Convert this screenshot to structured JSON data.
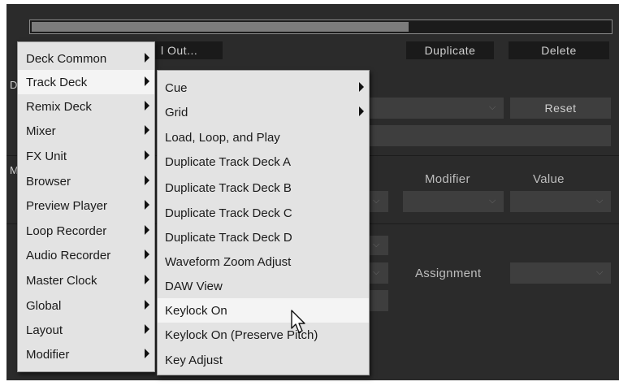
{
  "panel": {
    "progress_fraction": 0.65,
    "buttons": {
      "mapout_label": "l Out...",
      "duplicate_label": "Duplicate",
      "delete_label": "Delete",
      "reset_label": "Reset"
    },
    "headers": {
      "modifier_label": "Modifier",
      "value_label": "Value",
      "assignment_label": "Assignment"
    },
    "edge_marks": {
      "a": "D",
      "b": "M"
    }
  },
  "menu_main": {
    "items": [
      {
        "label": "Deck Common",
        "has_submenu": true
      },
      {
        "label": "Track Deck",
        "has_submenu": true
      },
      {
        "label": "Remix Deck",
        "has_submenu": true
      },
      {
        "label": "Mixer",
        "has_submenu": true
      },
      {
        "label": "FX Unit",
        "has_submenu": true
      },
      {
        "label": "Browser",
        "has_submenu": true
      },
      {
        "label": "Preview Player",
        "has_submenu": true
      },
      {
        "label": "Loop Recorder",
        "has_submenu": true
      },
      {
        "label": "Audio Recorder",
        "has_submenu": true
      },
      {
        "label": "Master Clock",
        "has_submenu": true
      },
      {
        "label": "Global",
        "has_submenu": true
      },
      {
        "label": "Layout",
        "has_submenu": true
      },
      {
        "label": "Modifier",
        "has_submenu": true
      }
    ],
    "selected_index": 1
  },
  "menu_track_deck": {
    "items": [
      {
        "label": "Cue",
        "has_submenu": true
      },
      {
        "label": "Grid",
        "has_submenu": true
      },
      {
        "label": "Load, Loop, and Play",
        "has_submenu": false
      },
      {
        "label": "Duplicate Track Deck A",
        "has_submenu": false
      },
      {
        "label": "Duplicate Track Deck B",
        "has_submenu": false
      },
      {
        "label": "Duplicate Track Deck C",
        "has_submenu": false
      },
      {
        "label": "Duplicate Track Deck D",
        "has_submenu": false
      },
      {
        "label": "Waveform Zoom Adjust",
        "has_submenu": false
      },
      {
        "label": "DAW View",
        "has_submenu": false
      },
      {
        "label": "Keylock On",
        "has_submenu": false
      },
      {
        "label": "Keylock On (Preserve Pitch)",
        "has_submenu": false
      },
      {
        "label": "Key Adjust",
        "has_submenu": false
      }
    ],
    "hovered_index": 9
  },
  "colors": {
    "panel_bg": "#2b2b2b",
    "menu_bg": "#e3e3e3",
    "menu_selected": "#f4f4f4",
    "button_bg": "#1a1a1a"
  }
}
